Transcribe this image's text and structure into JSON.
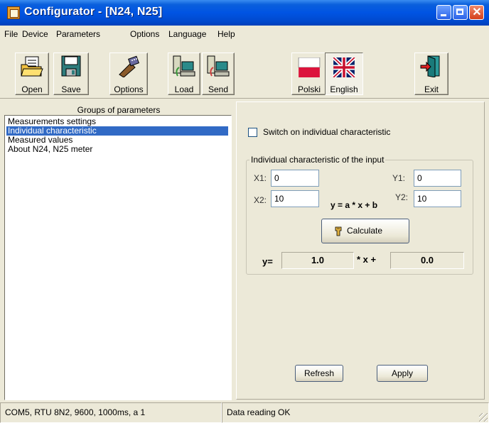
{
  "window": {
    "title": "Configurator - [N24, N25]"
  },
  "menu": [
    "File",
    "Device",
    "Parameters",
    "Options",
    "Language",
    "Help"
  ],
  "toolbar": {
    "open_label": "Open",
    "save_label": "Save",
    "options_label": "Options",
    "load_label": "Load",
    "send_label": "Send",
    "polski_label": "Polski",
    "english_label": "English",
    "exit_label": "Exit"
  },
  "groups": {
    "header": "Groups of parameters",
    "items": [
      {
        "label": "Measurements settings",
        "selected": false
      },
      {
        "label": "Individual characteristic",
        "selected": true
      },
      {
        "label": "Measured values",
        "selected": false
      },
      {
        "label": "About N24, N25 meter",
        "selected": false
      }
    ]
  },
  "individual": {
    "switch_label": "Switch on individual characteristic",
    "switch_checked": false,
    "group_title": "Individual characteristic of the input",
    "x1_label": "X1:",
    "x1_value": "0",
    "y1_label": "Y1:",
    "y1_value": "0",
    "x2_label": "X2:",
    "x2_value": "10",
    "y2_label": "Y2:",
    "y2_value": "10",
    "formula": "y = a * x + b",
    "calculate_label": "Calculate",
    "result_y_label": "y=",
    "result_a": "1.0",
    "result_mid_label": "* x +",
    "result_b": "0.0"
  },
  "actions": {
    "refresh_label": "Refresh",
    "apply_label": "Apply"
  },
  "status": {
    "connection": "COM5, RTU 8N2, 9600, 1000ms, a 1",
    "message": "Data reading OK"
  },
  "colors": {
    "title_bar": "#0054e3",
    "selection": "#316ac5",
    "window_bg": "#ece9d8"
  }
}
